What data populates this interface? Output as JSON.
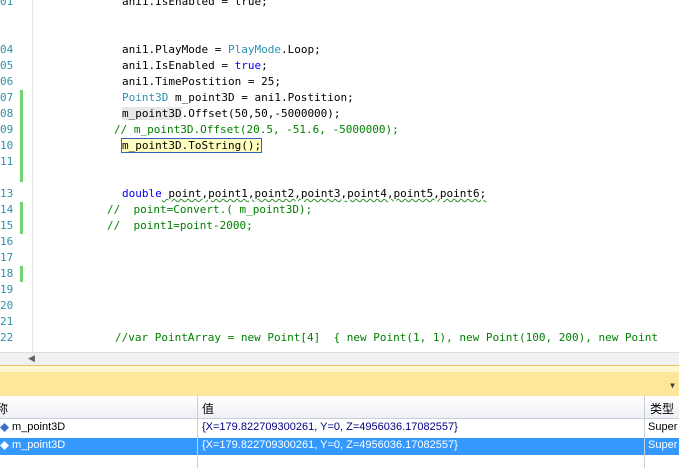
{
  "editor": {
    "line_numbers": [
      "01",
      "",
      "",
      "04",
      "05",
      "06",
      "07",
      "08",
      "09",
      "10",
      "11",
      "",
      "13",
      "14",
      "15",
      "16",
      "17",
      "18",
      "19",
      "20",
      "21",
      "22"
    ],
    "lines": {
      "l01": "ani1.IsEnabled = true;",
      "l04_a": "ani1.PlayMode = ",
      "l04_b": "PlayMode",
      "l04_c": ".Loop;",
      "l05_a": "ani1.IsEnabled = ",
      "l05_b": "true",
      "l05_c": ";",
      "l06": "ani1.TimePostition = 25;",
      "l07_a": "Point3D",
      "l07_b": " m_point3D = ani1.Postition;",
      "l08_a": "m_point3D",
      "l08_b": ".Offset(50,50,-5000000);",
      "l09": "// m_point3D.Offset(20.5, -51.6, -5000000);",
      "l10": "m_point3D.ToString();",
      "l13_a": "double",
      "l13_b": " point,point1,point2,point3,point4,point5,point6;",
      "l14": "//  point=Convert.( m_point3D);",
      "l15": "//  point1=point-2000;",
      "l22": "//var PointArray = new Point[4]  { new Point(1, 1), new Point(100, 200), new Point"
    }
  },
  "watch": {
    "col_name": "称",
    "col_value": "值",
    "col_type": "类型",
    "rows": [
      {
        "name": "m_point3D",
        "value": "{X=179.822709300261, Y=0, Z=4956036.17082557}",
        "type": "Super"
      },
      {
        "name": "m_point3D",
        "value": "{X=179.822709300261, Y=0, Z=4956036.17082557}",
        "type": "Super"
      }
    ]
  },
  "colors": {
    "accent_selection": "#3399ff",
    "panel_header": "#fde79a",
    "change_bar": "#6fd36f"
  }
}
